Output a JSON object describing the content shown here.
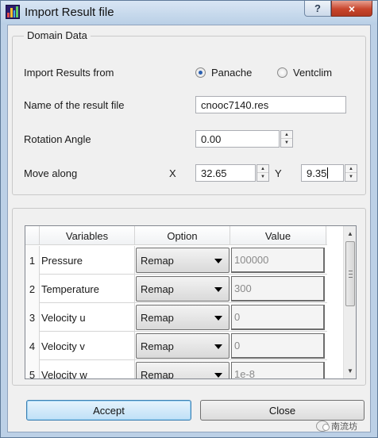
{
  "window": {
    "title": "Import Result file",
    "help_label": "?",
    "close_label": "×"
  },
  "domain": {
    "group_title": "Domain Data",
    "import_from_label": "Import Results from",
    "import_options": [
      {
        "label": "Panache",
        "checked": true
      },
      {
        "label": "Ventclim",
        "checked": false
      }
    ],
    "filename_label": "Name of the result file",
    "filename_value": "cnooc7140.res",
    "rotation_label": "Rotation Angle",
    "rotation_value": "0.00",
    "move_label": "Move along",
    "x_label": "X",
    "x_value": "32.65",
    "y_label": "Y",
    "y_value": "9.35"
  },
  "table": {
    "headers": [
      "Variables",
      "Option",
      "Value"
    ],
    "rows": [
      {
        "num": "1",
        "variable": "Pressure",
        "option": "Remap",
        "value": "100000"
      },
      {
        "num": "2",
        "variable": "Temperature",
        "option": "Remap",
        "value": "300"
      },
      {
        "num": "3",
        "variable": "Velocity u",
        "option": "Remap",
        "value": "0"
      },
      {
        "num": "4",
        "variable": "Velocity v",
        "option": "Remap",
        "value": "0"
      },
      {
        "num": "5",
        "variable": "Velocity w",
        "option": "Remap",
        "value": "1e-8"
      }
    ]
  },
  "buttons": {
    "accept": "Accept",
    "close": "Close"
  },
  "watermark": {
    "text": "南流坊"
  },
  "colors": {
    "title_gradient_top": "#d9e6f4",
    "close_red": "#c8452c",
    "primary_border": "#3c7fb1"
  }
}
